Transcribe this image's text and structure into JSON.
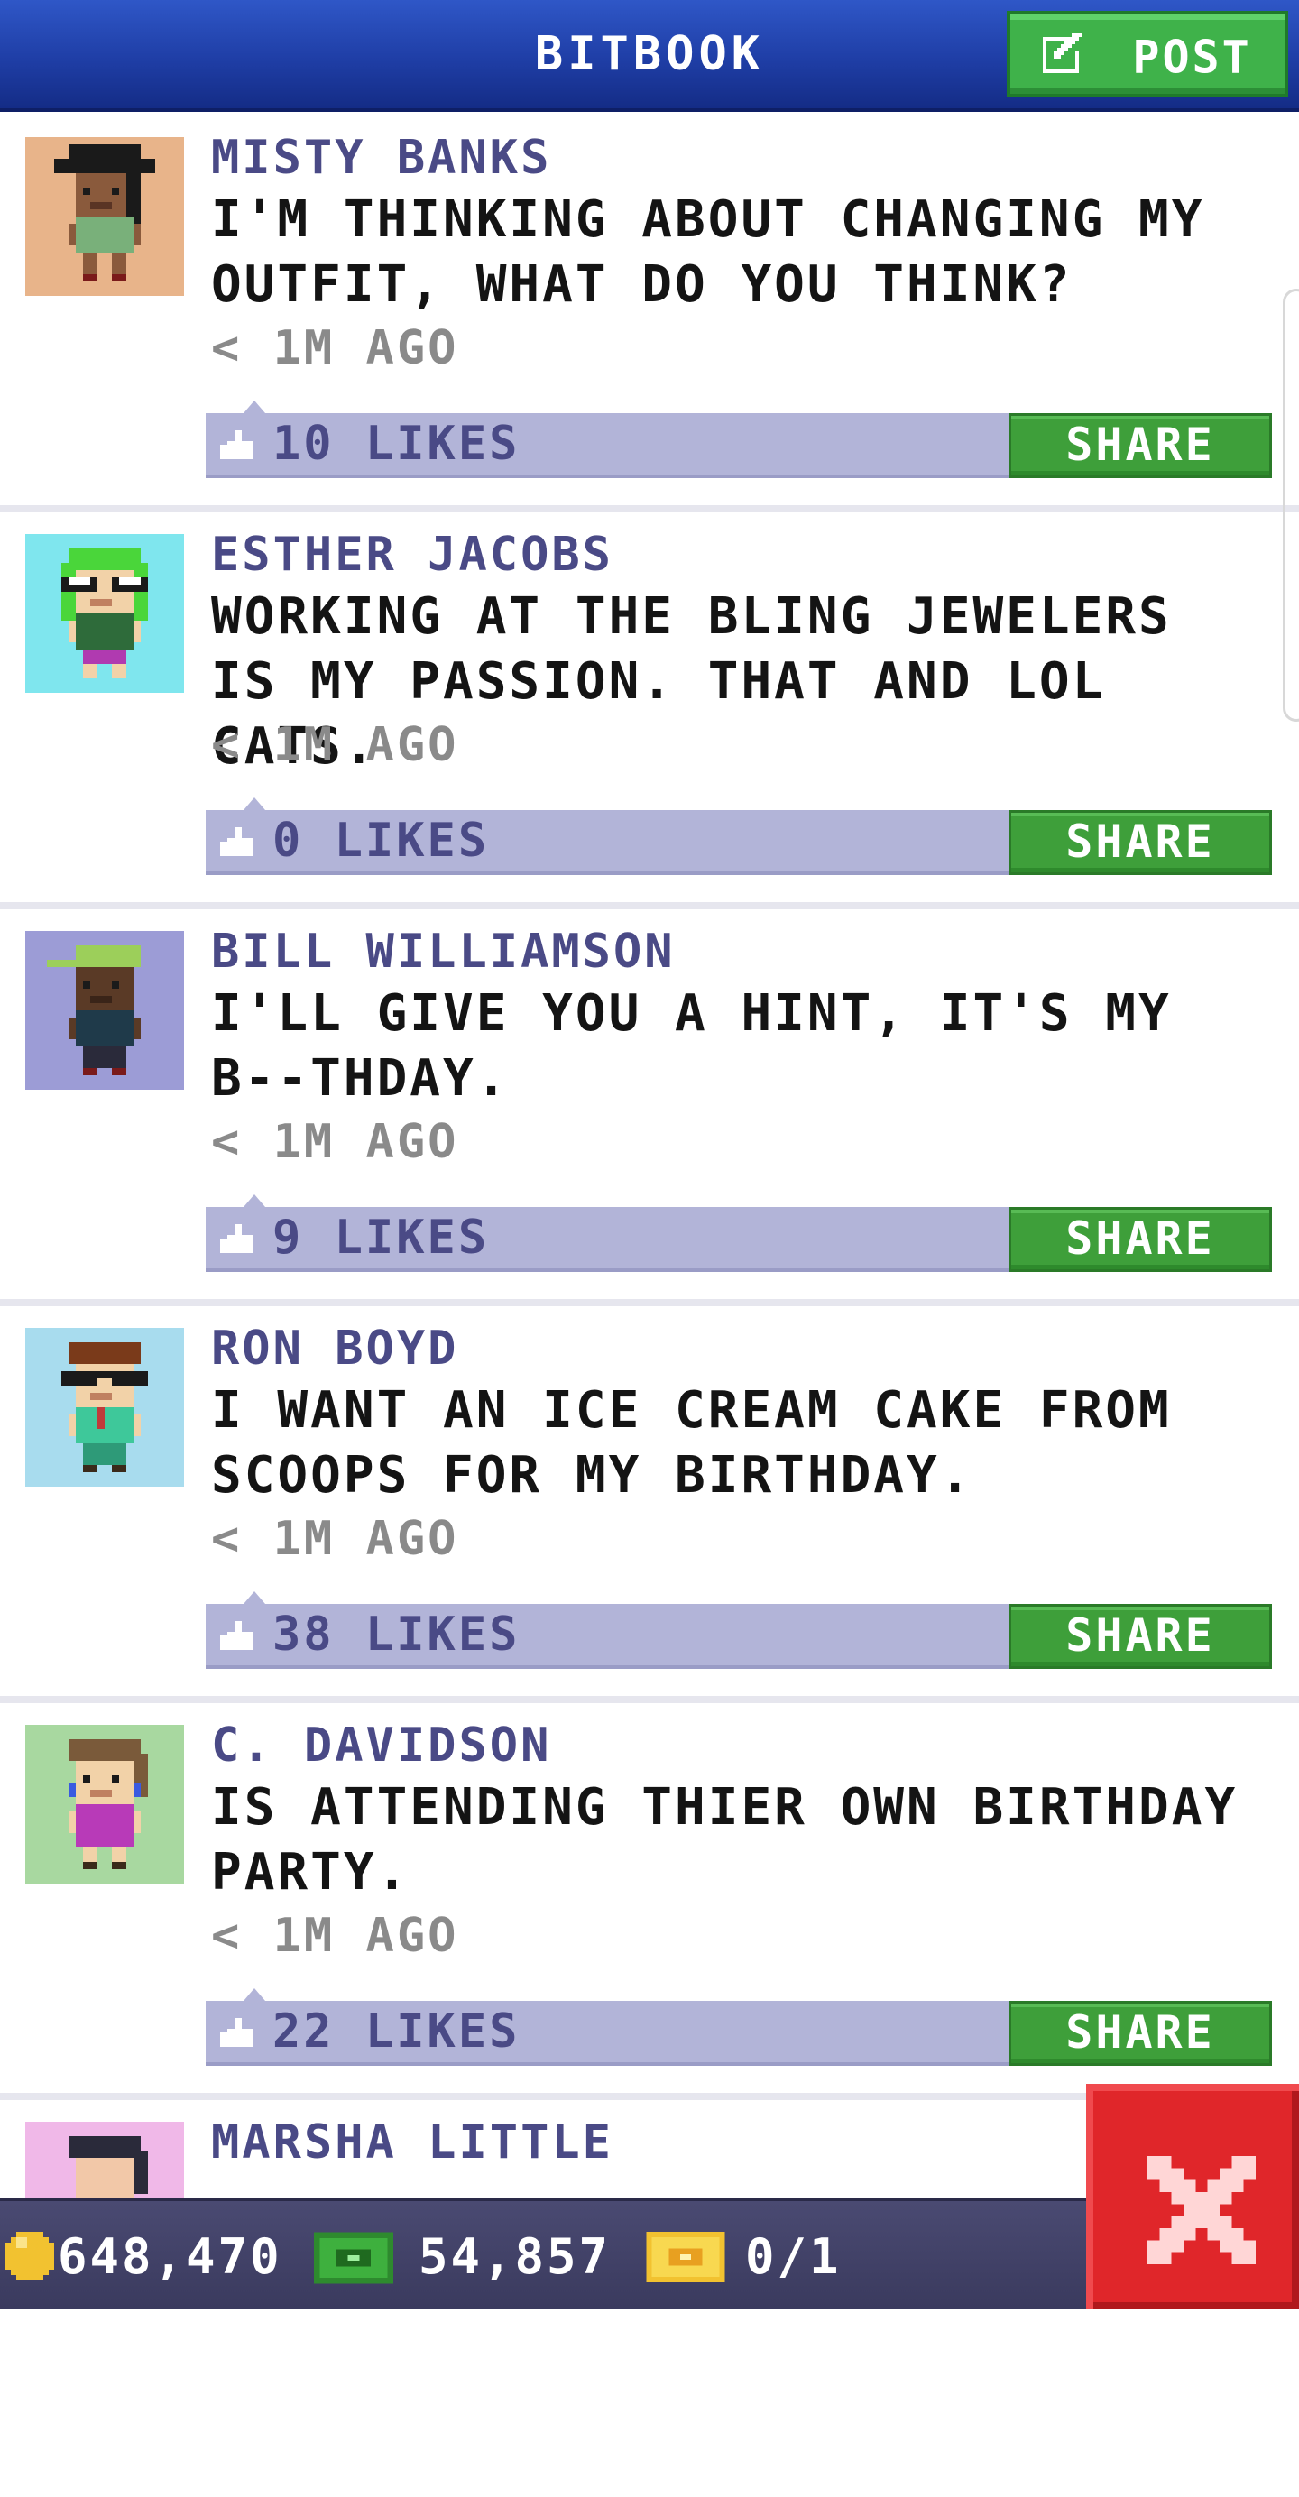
{
  "header": {
    "title": "BITBOOK",
    "post_label": "POST"
  },
  "posts": [
    {
      "author": "MISTY BANKS",
      "message": "I'M THINKING ABOUT CHANGING MY OUTFIT, WHAT DO YOU THINK?",
      "time": "< 1M AGO",
      "likes": "10 LIKES",
      "share_label": "SHARE",
      "avatar": {
        "bg": "#e8b48a",
        "skin": "#8a5a3c",
        "hair": "#1a1a1a",
        "shirt": "#79b07a",
        "hat": "top-hat",
        "glasses": false
      }
    },
    {
      "author": "ESTHER JACOBS",
      "message": "WORKING AT THE BLING JEWELERS IS MY PASSION. THAT AND LOL CATS.",
      "time": "< 1M AGO",
      "likes": "0 LIKES",
      "share_label": "SHARE",
      "avatar": {
        "bg": "#7fe6ee",
        "skin": "#f2d2a8",
        "hair": "#4ad63a",
        "shirt": "#2e6b3a",
        "hat": "none",
        "glasses": true
      }
    },
    {
      "author": "BILL WILLIAMSON",
      "message": "I'LL GIVE YOU A HINT, IT'S MY B--THDAY.",
      "time": "< 1M AGO",
      "likes": "9 LIKES",
      "share_label": "SHARE",
      "avatar": {
        "bg": "#9c9cd6",
        "skin": "#5a3a26",
        "hair": "#1a1a1a",
        "shirt": "#1f3a4a",
        "hat": "cap",
        "glasses": false
      }
    },
    {
      "author": "RON BOYD",
      "message": "I WANT AN ICE CREAM CAKE FROM SCOOPS FOR MY BIRTHDAY.",
      "time": "< 1M AGO",
      "likes": "38 LIKES",
      "share_label": "SHARE",
      "avatar": {
        "bg": "#a8dcee",
        "skin": "#f2d2a8",
        "hair": "#7a3a1a",
        "shirt": "#3ec89a",
        "hat": "none",
        "glasses": true
      }
    },
    {
      "author": "C. DAVIDSON",
      "message": "IS ATTENDING THIER OWN BIRTHDAY PARTY.",
      "time": "< 1M AGO",
      "likes": "22 LIKES",
      "share_label": "SHARE",
      "avatar": {
        "bg": "#a8d8a0",
        "skin": "#f2d2a8",
        "hair": "#7a5a3a",
        "shirt": "#b83ab8",
        "hat": "none",
        "glasses": false
      }
    },
    {
      "author": "MARSHA LITTLE",
      "message": "",
      "time": "",
      "likes": "",
      "share_label": "",
      "avatar": {
        "bg": "#f0b8e8",
        "skin": "#f2c8a8",
        "hair": "#2a2a3a",
        "shirt": "#f0b8e8",
        "hat": "none",
        "glasses": false
      }
    }
  ],
  "status": {
    "coins": "648,470",
    "bux": "54,857",
    "tickets": "0/1"
  },
  "colors": {
    "header_blue": "#1f3ea6",
    "post_green": "#3fb24a",
    "like_bar": "#b2b4d8",
    "author_text": "#4a4a86",
    "close_red": "#e0262a"
  },
  "icons": {
    "post": "edit-icon",
    "like": "thumbs-up-icon",
    "coin": "coin-icon",
    "bux": "cash-icon",
    "ticket": "ticket-icon",
    "close": "close-icon"
  }
}
